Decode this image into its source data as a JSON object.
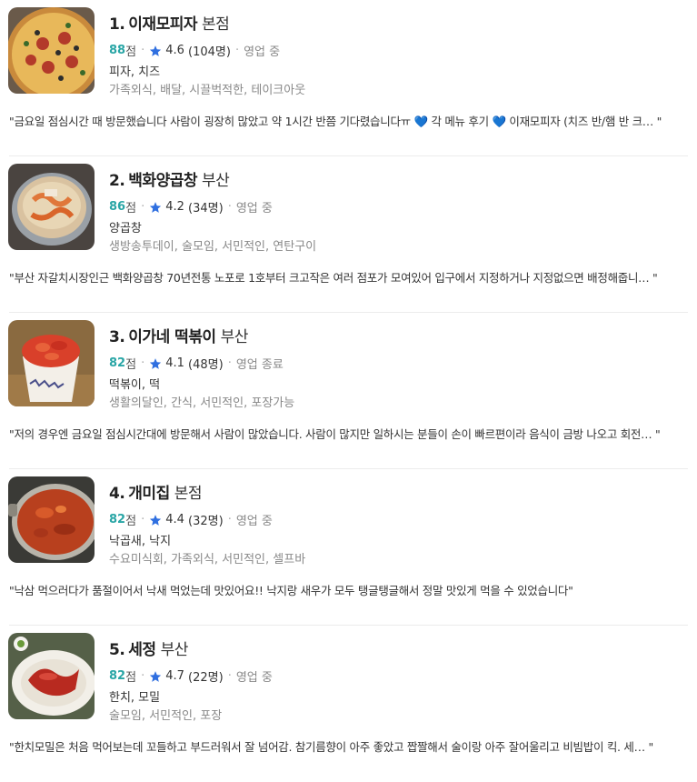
{
  "restaurants": [
    {
      "rank": "1.",
      "name": "이재모피자",
      "branch": "본점",
      "score": "88",
      "score_unit": "점",
      "rating": "4.6",
      "reviews": "(104명)",
      "status": "영업 중",
      "categories": "피자, 치즈",
      "tags": "가족외식, 배달, 시끌벅적한, 테이크아웃",
      "review": "\"금요일 점심시간 때 방문했습니다 사람이 굉장히 많았고 약 1시간 반쯤 기다렸습니다ㅠ 💙 각 메뉴 후기 💙 이재모피자 (치즈 반/햄 반 크…  \""
    },
    {
      "rank": "2.",
      "name": "백화양곱창",
      "branch": "부산",
      "score": "86",
      "score_unit": "점",
      "rating": "4.2",
      "reviews": "(34명)",
      "status": "영업 중",
      "categories": "양곱창",
      "tags": "생방송투데이, 술모임, 서민적인, 연탄구이",
      "review": "\"부산 자갈치시장인근 백화양곱창 70년전통 노포로 1호부터 크고작은 여러 점포가 모여있어 입구에서 지정하거나 지정없으면 배정해줍니…  \""
    },
    {
      "rank": "3.",
      "name": "이가네 떡볶이",
      "branch": "부산",
      "score": "82",
      "score_unit": "점",
      "rating": "4.1",
      "reviews": "(48명)",
      "status": "영업 종료",
      "categories": "떡볶이, 떡",
      "tags": "생활의달인, 간식, 서민적인, 포장가능",
      "review": "\"저의 경우엔 금요일 점심시간대에 방문해서 사람이 많았습니다. 사람이 많지만 일하시는 분들이 손이 빠르편이라 음식이 금방 나오고 회전…  \""
    },
    {
      "rank": "4.",
      "name": "개미집",
      "branch": "본점",
      "score": "82",
      "score_unit": "점",
      "rating": "4.4",
      "reviews": "(32명)",
      "status": "영업 중",
      "categories": "낙곱새, 낙지",
      "tags": "수요미식회, 가족외식, 서민적인, 셀프바",
      "review": "\"낙삼 먹으러다가 품절이어서 낙새 먹었는데 맛있어요!! 낙지랑 새우가 모두 탱글탱글해서 정말 맛있게 먹을 수 있었습니다\""
    },
    {
      "rank": "5.",
      "name": "세정",
      "branch": "부산",
      "score": "82",
      "score_unit": "점",
      "rating": "4.7",
      "reviews": "(22명)",
      "status": "영업 중",
      "categories": "한치, 모밀",
      "tags": "술모임, 서민적인, 포장",
      "review": "\"한치모밀은 처음 먹어보는데 꼬들하고 부드러워서 잘 넘어감. 참기름향이 아주 좋았고 짭짤해서 술이랑 아주 잘어울리고 비빔밥이 킥. 세…  \""
    }
  ],
  "thumbnails": [
    "pizza-photo",
    "gopchang-soup-photo",
    "tteokbokki-cup-photo",
    "nakgopsae-pot-photo",
    "hanchi-dish-photo"
  ],
  "colors": {
    "score": "#2aa6a6",
    "star": "#2f6fe0",
    "divider": "#ececec"
  }
}
